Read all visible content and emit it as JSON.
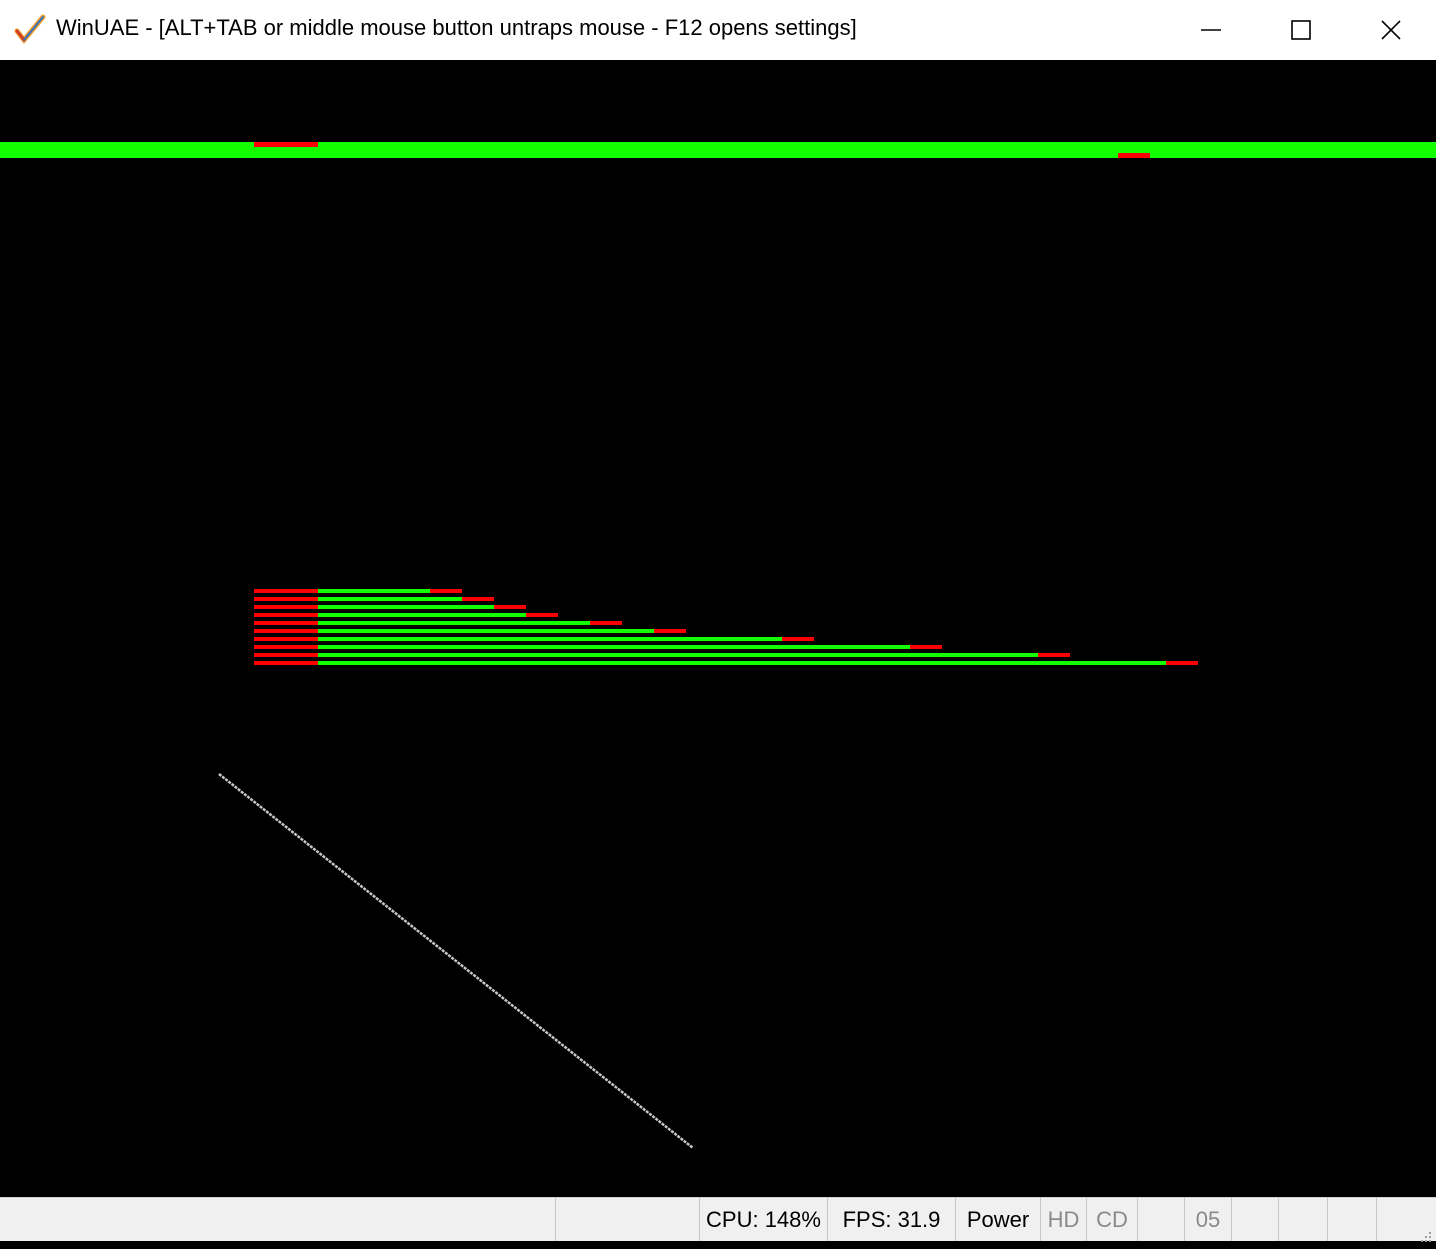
{
  "window": {
    "title": "WinUAE - [ALT+TAB or middle mouse button untraps mouse - F12 opens settings]",
    "icon": "winuae-checkmark-icon",
    "controls": [
      "minimize-icon",
      "maximize-icon",
      "close-icon"
    ]
  },
  "status": {
    "cpu": "CPU: 148%",
    "fps": "FPS: 31.9",
    "power": "Power",
    "hd": "HD",
    "cd": "CD",
    "drive": "05"
  },
  "colors": {
    "green": "#11ff00",
    "red": "#ff0000",
    "line": "#c8c8c8",
    "background": "#000000"
  }
}
